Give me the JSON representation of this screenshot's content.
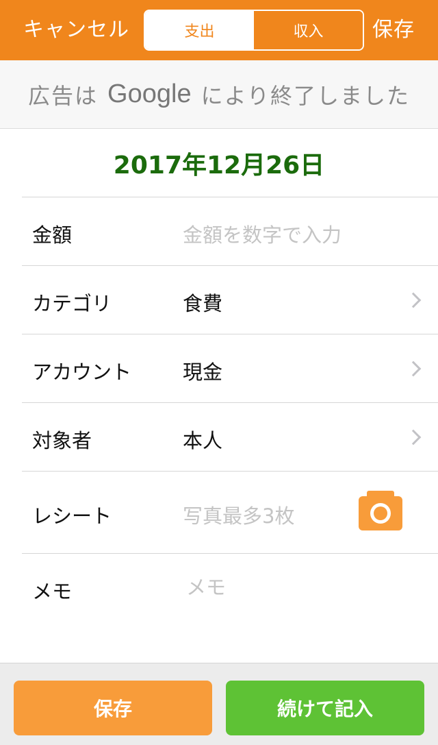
{
  "navbar": {
    "cancel_label": "キャンセル",
    "save_label": "保存",
    "segments": [
      {
        "label": "支出",
        "selected": true
      },
      {
        "label": "収入",
        "selected": false
      }
    ],
    "accent_color": "#f0861c"
  },
  "ad_banner": {
    "prefix": "広告は",
    "brand": "Google",
    "suffix": "により終了しました"
  },
  "date": {
    "text": "2017年12月26日",
    "color": "#1b6b0c"
  },
  "form": {
    "amount": {
      "label": "金額",
      "placeholder": "金額を数字で入力"
    },
    "category": {
      "label": "カテゴリ",
      "value": "食費"
    },
    "account": {
      "label": "アカウント",
      "value": "現金"
    },
    "person": {
      "label": "対象者",
      "value": "本人"
    },
    "receipt": {
      "label": "レシート",
      "placeholder": "写真最多3枚",
      "icon": "camera-icon"
    },
    "memo": {
      "label": "メモ",
      "placeholder": "メモ"
    }
  },
  "bottom": {
    "save_label": "保存",
    "continue_label": "続けて記入",
    "save_color": "#f89c3a",
    "continue_color": "#5ec235"
  }
}
